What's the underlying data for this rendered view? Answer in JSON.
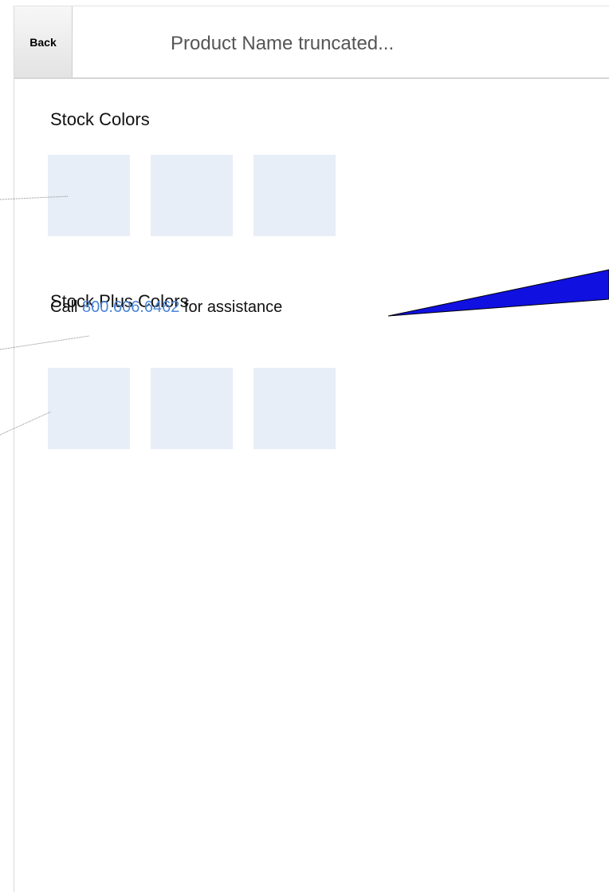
{
  "header": {
    "back_label": "Back",
    "title": "Product Name truncated..."
  },
  "stock_colors": {
    "title": "Stock Colors",
    "swatch_count": 3
  },
  "stock_plus_colors": {
    "title": "Stock Plus Colors",
    "help_prefix": "Call ",
    "phone": "800.606.6462",
    "help_suffix": " for assistance",
    "swatch_count": 3
  },
  "colors": {
    "swatch_fill": "#e8eef7",
    "link": "#4a86d6",
    "annotation_arrow": "#1010e0"
  }
}
